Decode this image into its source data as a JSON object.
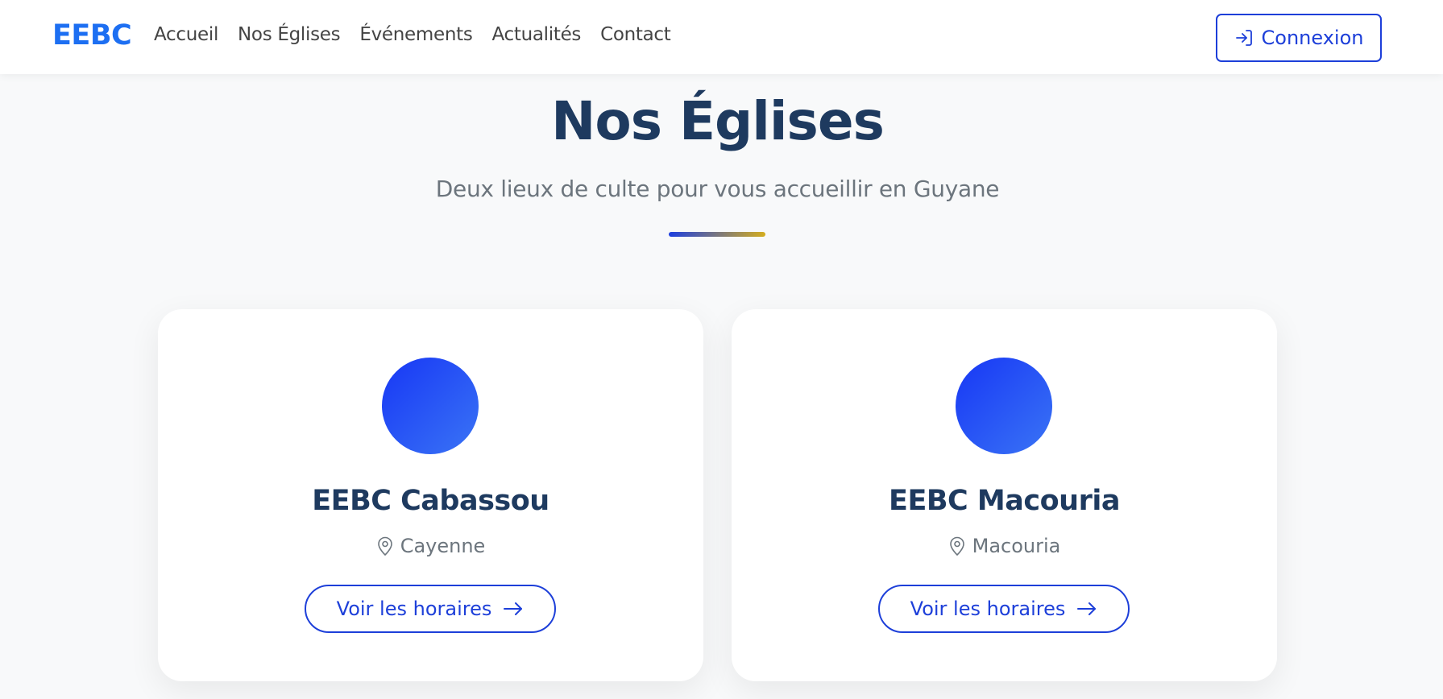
{
  "nav": {
    "brand": "EEBC",
    "links": [
      "Accueil",
      "Nos Églises",
      "Événements",
      "Actualités",
      "Contact"
    ],
    "login_label": "Connexion"
  },
  "hero": {
    "title": "Nos Églises",
    "subtitle": "Deux lieux de culte pour vous accueillir en Guyane"
  },
  "churches": [
    {
      "name": "EEBC Cabassou",
      "location": "Cayenne",
      "button_label": "Voir les horaires"
    },
    {
      "name": "EEBC Macouria",
      "location": "Macouria",
      "button_label": "Voir les horaires"
    }
  ],
  "colors": {
    "brand": "#1d6ff2",
    "primary": "#1d3fd9",
    "heading": "#1e3a5f",
    "muted": "#6c757d",
    "accent_gold": "#d4ad1e"
  },
  "icons": {
    "login": "login-icon",
    "location": "map-pin-icon",
    "arrow": "arrow-right-icon"
  }
}
